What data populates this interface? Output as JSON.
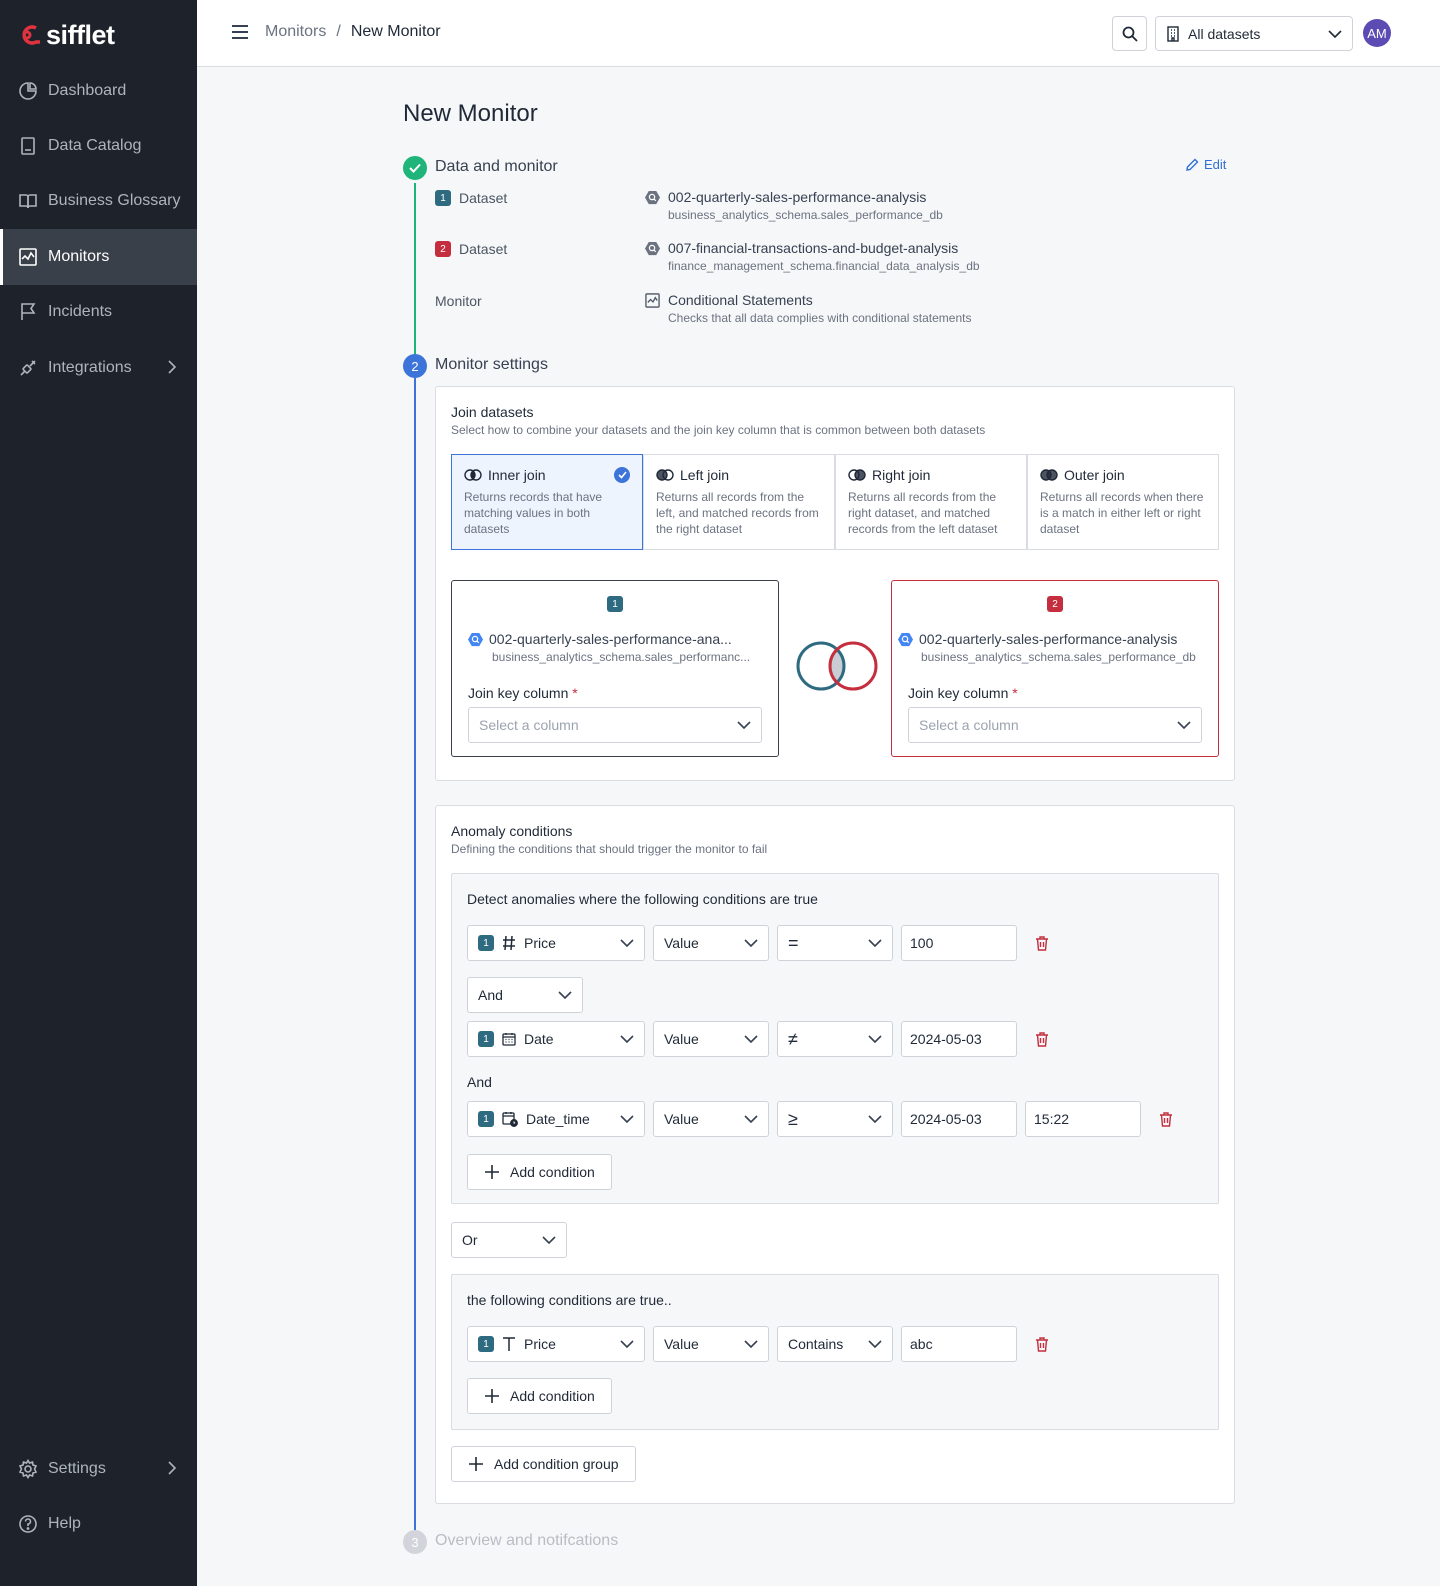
{
  "sidebar": {
    "logo": "sifflet",
    "items": [
      {
        "label": "Dashboard"
      },
      {
        "label": "Data Catalog"
      },
      {
        "label": "Business Glossary"
      },
      {
        "label": "Monitors"
      },
      {
        "label": "Incidents"
      },
      {
        "label": "Integrations"
      }
    ],
    "bottom": [
      {
        "label": "Settings"
      },
      {
        "label": "Help"
      }
    ]
  },
  "topbar": {
    "breadcrumb_parent": "Monitors",
    "breadcrumb_sep": "/",
    "breadcrumb_current": "New Monitor",
    "dataset_filter": "All datasets",
    "avatar": "AM"
  },
  "page": {
    "title": "New Monitor"
  },
  "step1": {
    "label": "Data and monitor",
    "edit": "Edit",
    "rows": [
      {
        "label": "Dataset",
        "badge": "1",
        "name": "002-quarterly-sales-performance-analysis",
        "sub": "business_analytics_schema.sales_performance_db"
      },
      {
        "label": "Dataset",
        "badge": "2",
        "name": "007-financial-transactions-and-budget-analysis",
        "sub": "finance_management_schema.financial_data_analysis_db"
      },
      {
        "label": "Monitor",
        "name": "Conditional Statements",
        "sub": "Checks that all data complies with conditional statements"
      }
    ]
  },
  "step2": {
    "number": "2",
    "label": "Monitor settings",
    "join": {
      "title": "Join datasets",
      "subtitle": "Select how to combine your datasets and the join key column that is common between both datasets",
      "options": [
        {
          "title": "Inner join",
          "desc": "Returns records that have matching values in both datasets"
        },
        {
          "title": "Left join",
          "desc": "Returns all records from the left, and matched records from the right dataset"
        },
        {
          "title": "Right join",
          "desc": "Returns all records from the right dataset, and matched records from the left dataset"
        },
        {
          "title": "Outer join",
          "desc": "Returns all records when there is a match in either left or right dataset"
        }
      ],
      "left": {
        "badge": "1",
        "name": "002-quarterly-sales-performance-ana...",
        "sub": "business_analytics_schema.sales_performanc...",
        "key_label": "Join key column",
        "req": "*",
        "placeholder": "Select a column"
      },
      "right": {
        "badge": "2",
        "name": "002-quarterly-sales-performance-analysis",
        "sub": "business_analytics_schema.sales_performance_db",
        "key_label": "Join key column",
        "req": "*",
        "placeholder": "Select a column"
      }
    },
    "anomaly": {
      "title": "Anomaly conditions",
      "subtitle": "Defining the conditions that should trigger the monitor to fail",
      "group1": {
        "title": "Detect anomalies where the following conditions are true",
        "rows": [
          {
            "badge": "1",
            "column": "Price",
            "type": "Value",
            "op": "=",
            "value": "100"
          },
          {
            "badge": "1",
            "column": "Date",
            "type": "Value",
            "op": "≠",
            "value": "2024-05-03"
          },
          {
            "badge": "1",
            "column": "Date_time",
            "type": "Value",
            "op": "≥",
            "value": "2024-05-03",
            "time": "15:22"
          }
        ],
        "connector_select": "And",
        "connector_text": "And",
        "add": "Add condition"
      },
      "group_connector": "Or",
      "group2": {
        "title": "the following conditions are true..",
        "rows": [
          {
            "badge": "1",
            "column": "Price",
            "type": "Value",
            "op": "Contains",
            "value": "abc"
          }
        ],
        "add": "Add condition"
      },
      "add_group": "Add condition group"
    }
  },
  "step3": {
    "number": "3",
    "label": "Overview and notifcations"
  },
  "colors": {
    "accent": "#3c74d9",
    "success": "#1fb57a",
    "danger": "#c52e3e",
    "teal": "#2e6b80"
  }
}
